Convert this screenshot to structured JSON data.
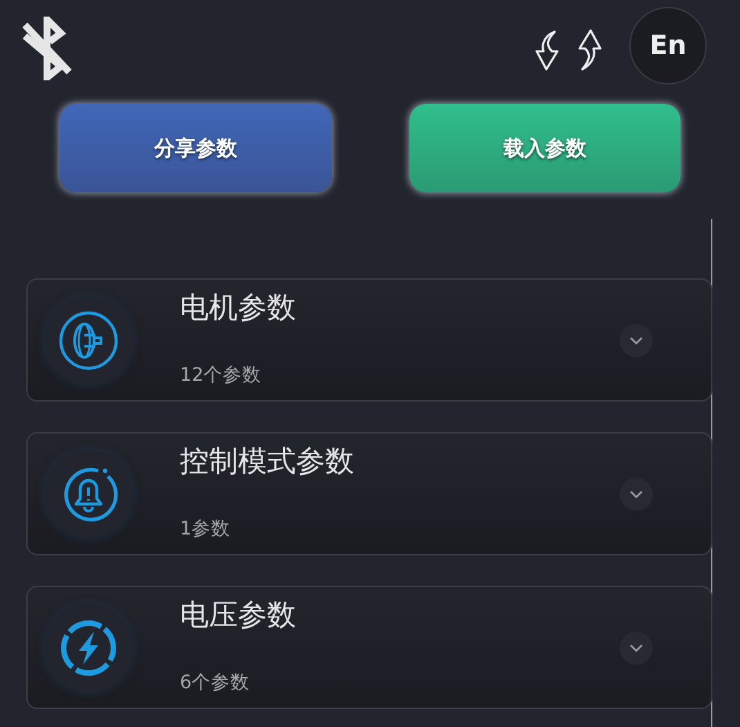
{
  "header": {
    "bluetooth_connected": false,
    "language_button": "En"
  },
  "actions": [
    {
      "label": "分享参数",
      "kind": "share"
    },
    {
      "label": "载入参数",
      "kind": "load"
    }
  ],
  "groups": [
    {
      "title": "电机参数",
      "count": "12个参数",
      "kind": "motor",
      "expanded": false
    },
    {
      "title": "控制模式参数",
      "count": "1参数",
      "kind": "alarm",
      "expanded": false
    },
    {
      "title": "电压参数",
      "count": "6个参数",
      "kind": "voltage",
      "expanded": false
    }
  ]
}
